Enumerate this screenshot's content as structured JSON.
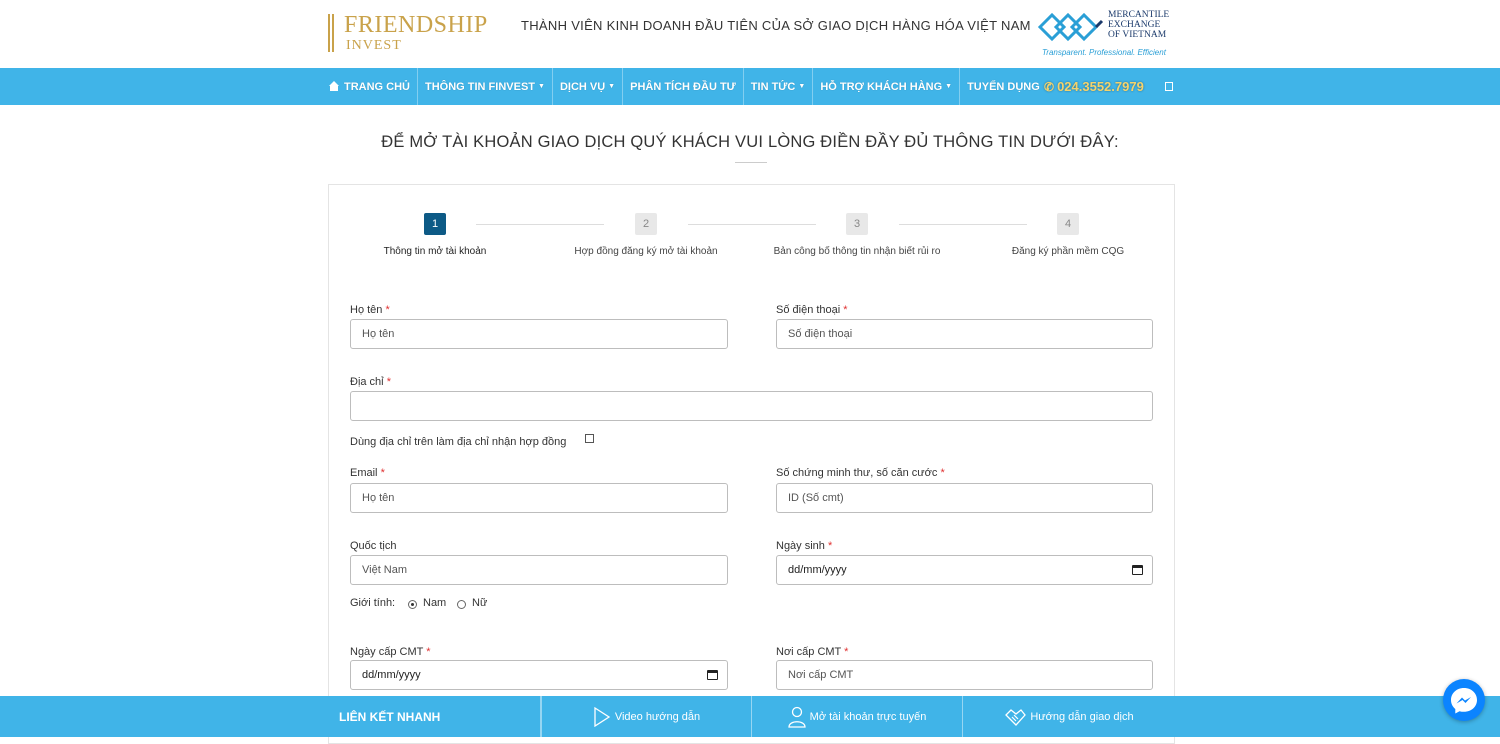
{
  "header": {
    "logo_line1": "FRIENDSHIP",
    "logo_line2": "INVEST",
    "tagline": "THÀNH VIÊN KINH DOANH ĐẦU TIÊN CỦA SỞ GIAO DỊCH HÀNG HÓA VIỆT NAM",
    "partner_line1": "MERCANTILE",
    "partner_line2": "EXCHANGE",
    "partner_line3": "OF VIETNAM",
    "partner_slogan": "Transparent. Professional. Efficient"
  },
  "nav": {
    "items": [
      {
        "label": "TRANG CHỦ"
      },
      {
        "label": "THÔNG TIN FINVEST"
      },
      {
        "label": "DỊCH VỤ"
      },
      {
        "label": "PHÂN TÍCH ĐẦU TƯ"
      },
      {
        "label": "TIN TỨC"
      },
      {
        "label": "HỖ TRỢ KHÁCH HÀNG"
      },
      {
        "label": "TUYỂN DỤNG"
      }
    ],
    "phone": "024.3552.7979"
  },
  "page": {
    "heading": "ĐỂ MỞ TÀI KHOẢN GIAO DỊCH QUÝ KHÁCH VUI LÒNG ĐIỀN ĐẦY ĐỦ THÔNG TIN DƯỚI ĐÂY:"
  },
  "steps": [
    {
      "num": "1",
      "label": "Thông tin mở tài khoản"
    },
    {
      "num": "2",
      "label": "Hợp đồng đăng ký mở tài khoản"
    },
    {
      "num": "3",
      "label": "Bản công bố thông tin nhận biết rủi ro"
    },
    {
      "num": "4",
      "label": "Đăng ký phần mềm CQG"
    }
  ],
  "form": {
    "fullname": {
      "label": "Họ tên",
      "placeholder": "Họ tên"
    },
    "phone": {
      "label": "Số điện thoại",
      "placeholder": "Số điện thoại"
    },
    "address": {
      "label": "Địa chỉ",
      "value": ""
    },
    "use_address": {
      "label": "Dùng địa chỉ trên làm địa chỉ nhận hợp đồng"
    },
    "email": {
      "label": "Email",
      "placeholder": "Họ tên"
    },
    "id_number": {
      "label": "Số chứng minh thư, số căn cước",
      "placeholder": "ID (Số cmt)"
    },
    "nationality": {
      "label": "Quốc tịch",
      "value": "Việt Nam"
    },
    "birthday": {
      "label": "Ngày sinh",
      "value": "dd/mm/yyyy"
    },
    "gender": {
      "label": "Giới tính:",
      "option_male": "Nam",
      "option_female": "Nữ",
      "selected": "Nam"
    },
    "id_issue_date": {
      "label": "Ngày cấp CMT",
      "value": "dd/mm/yyyy"
    },
    "id_issue_place": {
      "label": "Nơi cấp CMT",
      "placeholder": "Nơi cấp CMT"
    },
    "required_mark": "*"
  },
  "footer": {
    "quick_links": "LIÊN KẾT NHANH",
    "video_guide": "Video hướng dẫn",
    "open_account": "Mở tài khoản trực tuyến",
    "trading_guide": "Hướng dẫn giao dịch"
  },
  "colors": {
    "brand_gold": "#c9a24a",
    "nav_blue": "#40b4e8",
    "step_active": "#0d5a86",
    "required_red": "#e03131",
    "phone_yellow": "#f5d36c"
  }
}
